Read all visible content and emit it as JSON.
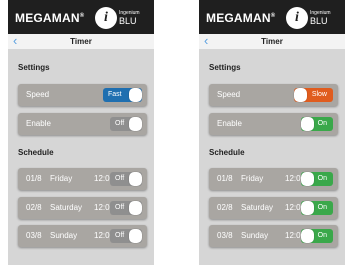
{
  "colors": {
    "header_bg": "#1f1f1f",
    "screen_bg": "#d6d6d6",
    "row_bg": "#a9a6a2",
    "toggle_fast": "#1f6fb0",
    "toggle_off": "#8f8f8f",
    "toggle_slow": "#e05c1e",
    "toggle_on": "#3aa84a",
    "back_arrow": "#5aa0e0"
  },
  "screens": [
    {
      "brand": "MEGAMAN",
      "logo_small": "Ingenium",
      "logo_big": "BLU",
      "title": "Timer",
      "settings_title": "Settings",
      "speed": {
        "label": "Speed",
        "state": "Fast"
      },
      "enable": {
        "label": "Enable",
        "state": "Off"
      },
      "schedule_title": "Schedule",
      "schedule": [
        {
          "date": "01/8",
          "day": "Friday",
          "time": "12:00",
          "state": "Off"
        },
        {
          "date": "02/8",
          "day": "Saturday",
          "time": "12:00",
          "state": "Off"
        },
        {
          "date": "03/8",
          "day": "Sunday",
          "time": "12:00",
          "state": "Off"
        }
      ]
    },
    {
      "brand": "MEGAMAN",
      "logo_small": "Ingenium",
      "logo_big": "BLU",
      "title": "Timer",
      "settings_title": "Settings",
      "speed": {
        "label": "Speed",
        "state": "Slow"
      },
      "enable": {
        "label": "Enable",
        "state": "On"
      },
      "schedule_title": "Schedule",
      "schedule": [
        {
          "date": "01/8",
          "day": "Friday",
          "time": "12:00",
          "state": "On"
        },
        {
          "date": "02/8",
          "day": "Saturday",
          "time": "12:00",
          "state": "On"
        },
        {
          "date": "03/8",
          "day": "Sunday",
          "time": "12:00",
          "state": "On"
        }
      ]
    }
  ]
}
